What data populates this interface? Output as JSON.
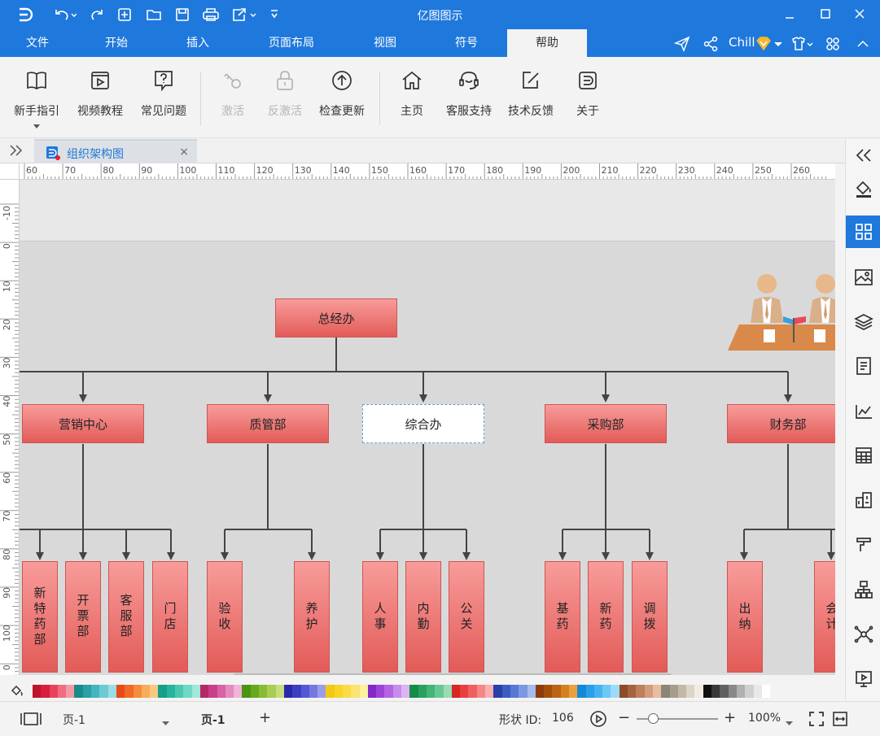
{
  "titlebar": {
    "app_title": "亿图图示"
  },
  "menu": {
    "tabs": [
      "文件",
      "开始",
      "插入",
      "页面布局",
      "视图",
      "符号",
      "帮助"
    ],
    "active_tab": "帮助",
    "user_name": "Chill"
  },
  "ribbon": {
    "buttons": [
      {
        "label": "新手指引",
        "icon": "book-icon",
        "enabled": true
      },
      {
        "label": "视频教程",
        "icon": "video-icon",
        "enabled": true
      },
      {
        "label": "常见问题",
        "icon": "question-icon",
        "enabled": true
      },
      {
        "label": "激活",
        "icon": "key-icon",
        "enabled": false
      },
      {
        "label": "反激活",
        "icon": "lock-icon",
        "enabled": false
      },
      {
        "label": "检查更新",
        "icon": "update-icon",
        "enabled": true
      },
      {
        "label": "主页",
        "icon": "home-icon",
        "enabled": true
      },
      {
        "label": "客服支持",
        "icon": "support-icon",
        "enabled": true
      },
      {
        "label": "技术反馈",
        "icon": "feedback-icon",
        "enabled": true
      },
      {
        "label": "关于",
        "icon": "about-icon",
        "enabled": true
      }
    ]
  },
  "document": {
    "tab_title": "组织架构图",
    "close_glyph": "×"
  },
  "rulers": {
    "horizontal": [
      "60",
      "70",
      "80",
      "90",
      "100",
      "110",
      "120",
      "130",
      "140",
      "150",
      "160",
      "170",
      "180",
      "190",
      "200",
      "210",
      "220",
      "230",
      "240",
      "250",
      "260"
    ],
    "vertical": [
      "-10",
      "0",
      "10",
      "20",
      "30",
      "40",
      "50",
      "60",
      "70",
      "80",
      "90",
      "100",
      "0"
    ]
  },
  "org_chart": {
    "root": "总经办",
    "departments": [
      "营销中心",
      "质管部",
      "综合办",
      "采购部",
      "财务部"
    ],
    "selected_department": "综合办",
    "sub_units": {
      "营销中心": [
        "新特药部",
        "开票部",
        "客服部",
        "门店"
      ],
      "质管部": [
        "验收",
        "养护"
      ],
      "综合办": [
        "人事",
        "内勤",
        "公关"
      ],
      "采购部": [
        "基药",
        "新药",
        "调拨"
      ],
      "财务部": [
        "出纳",
        "会计"
      ]
    }
  },
  "palette": {
    "colors": [
      "#c0142a",
      "#d81e3c",
      "#e8425a",
      "#ef6d80",
      "#f49aa6",
      "#1a8a8a",
      "#2aa0a8",
      "#44b4c0",
      "#6ccad4",
      "#9adde4",
      "#e84a1a",
      "#f06a28",
      "#f48c3c",
      "#f8ac5c",
      "#fbc882",
      "#14a088",
      "#28b49c",
      "#48c8b0",
      "#70d8c4",
      "#a0e8d8",
      "#b42868",
      "#c8408a",
      "#d862a4",
      "#e48abe",
      "#f0b4d6",
      "#4a9414",
      "#68a820",
      "#88bc34",
      "#a8cc54",
      "#c8dc80",
      "#2828a8",
      "#3c40c0",
      "#5458d4",
      "#7478e0",
      "#9c9cec",
      "#f4c814",
      "#f8d428",
      "#fadc48",
      "#fce470",
      "#fdf0a0",
      "#8228c8",
      "#9c44d8",
      "#b464e4",
      "#c88cec",
      "#dcb4f4",
      "#148c48",
      "#28a060",
      "#44b478",
      "#68c894",
      "#98dcb4",
      "#d82424",
      "#e84040",
      "#f06060",
      "#f48888",
      "#f8b0b0",
      "#2840a8",
      "#3c5cc0",
      "#5878d4",
      "#7c98e0",
      "#a4bcec",
      "#8c3c08",
      "#a4500c",
      "#bc6414",
      "#d48020",
      "#e8a040",
      "#1488d8",
      "#28a0e8",
      "#44b4f0",
      "#6cc8f4",
      "#9cdcf8",
      "#8c4c28",
      "#a46440",
      "#bc805c",
      "#d49c7c",
      "#e8bca0",
      "#8c8474",
      "#a89c8c",
      "#c4b8a8",
      "#dcd4c8",
      "#f0ece4",
      "#101010",
      "#383838",
      "#606060",
      "#888888",
      "#b0b0b0",
      "#d0d0d0",
      "#e8e8e8",
      "#ffffff"
    ]
  },
  "statusbar": {
    "page_selector": "页-1",
    "page_tab": "页-1",
    "add_page_glyph": "+",
    "shape_id_label": "形状 ID:",
    "shape_id_value": "106",
    "zoom_minus": "−",
    "zoom_plus": "+",
    "zoom_level": "100%",
    "zoom_fraction": 0.2
  }
}
